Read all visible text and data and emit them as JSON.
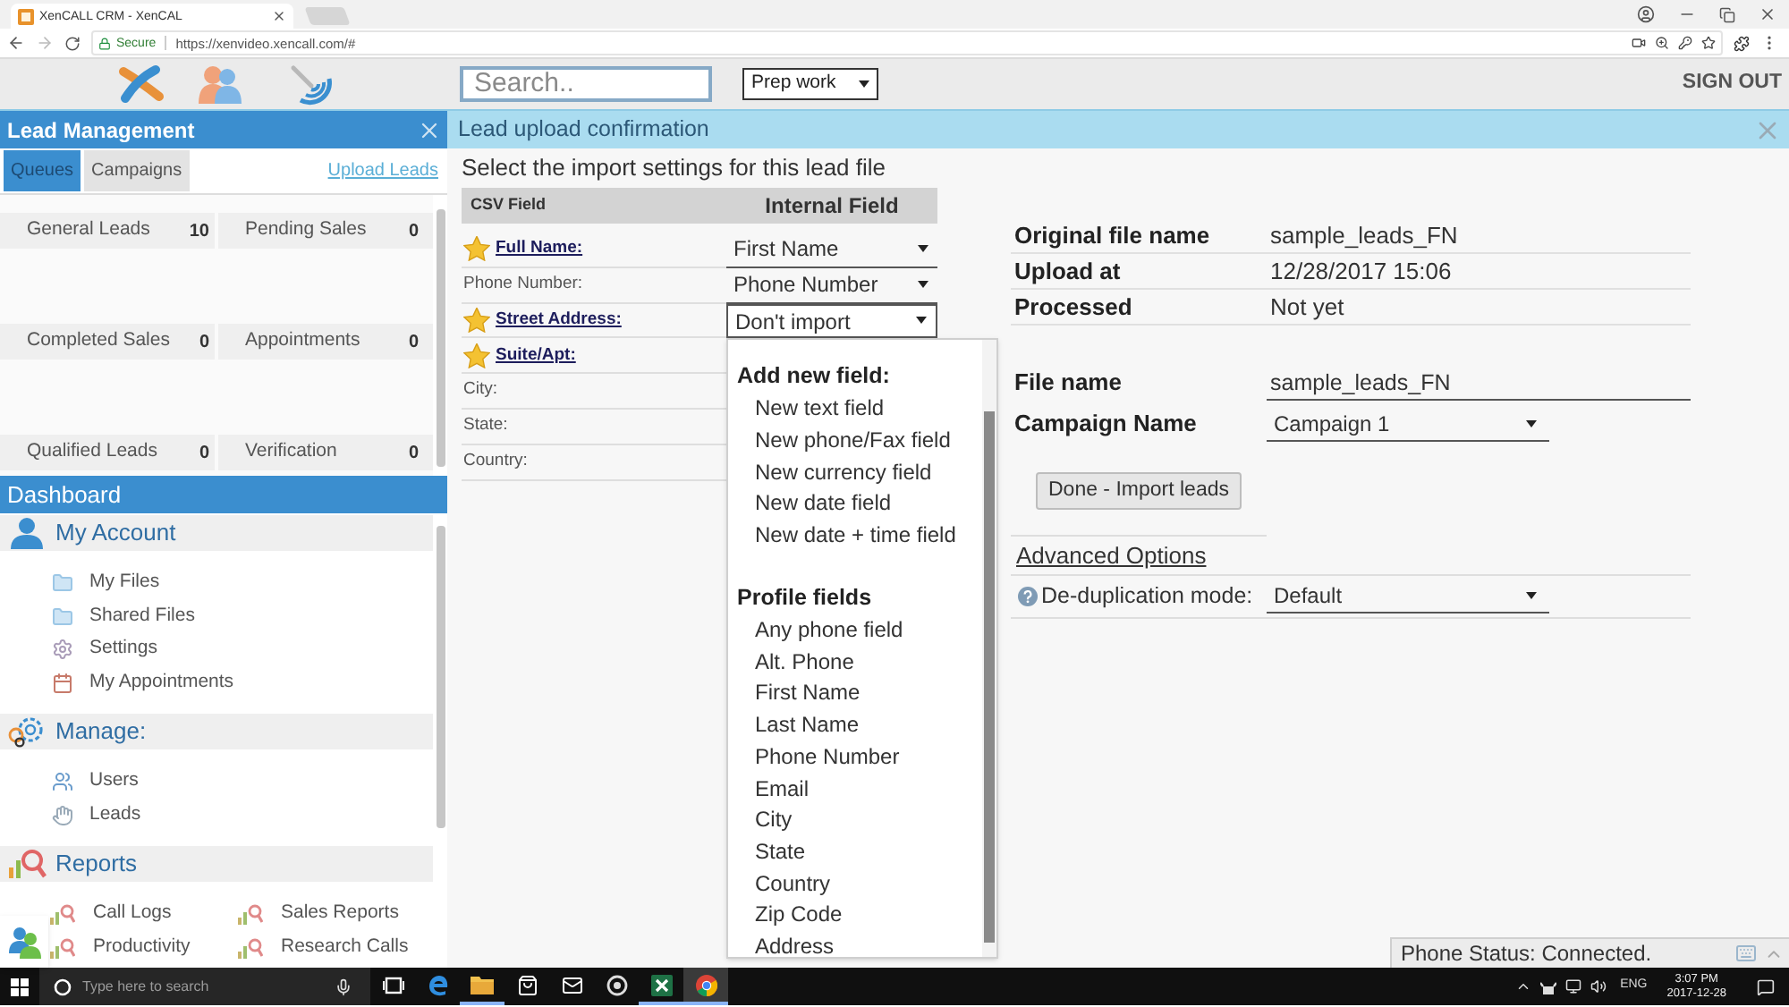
{
  "browser": {
    "tabs": [
      {
        "title": "XenCALL CRM - XenCAL",
        "selected": true
      }
    ],
    "secure_label": "Secure",
    "url": "https://xenvideo.xencall.com/#"
  },
  "header": {
    "search": {
      "placeholder": "Search.."
    },
    "status": {
      "value": "Prep work"
    },
    "sign_out": "SIGN OUT"
  },
  "lead_management": {
    "title": "Lead Management",
    "tabs": [
      {
        "label": "Queues",
        "selected": true
      },
      {
        "label": "Campaigns",
        "selected": false
      }
    ],
    "upload_link": "Upload Leads",
    "queues": [
      {
        "name": "General Leads",
        "count": "10"
      },
      {
        "name": "Pending Sales",
        "count": "0"
      },
      {
        "name": "Completed Sales",
        "count": "0"
      },
      {
        "name": "Appointments",
        "count": "0"
      },
      {
        "name": "Qualified Leads",
        "count": "0"
      },
      {
        "name": "Verification",
        "count": "0"
      }
    ]
  },
  "dashboard": {
    "title": "Dashboard",
    "sections": [
      {
        "title": "My Account",
        "kind": "list",
        "items": [
          "My Files",
          "Shared Files",
          "Settings",
          "My Appointments"
        ]
      },
      {
        "title": "Manage:",
        "kind": "list",
        "items": [
          "Users",
          "Leads"
        ]
      },
      {
        "title": "Reports",
        "kind": "grid",
        "items": [
          "Call Logs",
          "Sales Reports",
          "Productivity",
          "Research Calls"
        ]
      }
    ]
  },
  "upload": {
    "title": "Lead upload confirmation",
    "intro": "Select the import settings for this lead file",
    "mapping": {
      "columns": [
        "CSV Field",
        "Internal Field"
      ],
      "rows": [
        {
          "field": "Full Name:",
          "required": true,
          "value": "First Name",
          "expanded": false
        },
        {
          "field": "Phone Number:",
          "required": false,
          "value": "Phone Number",
          "expanded": false
        },
        {
          "field": "Street Address:",
          "required": true,
          "value": "Don't import",
          "expanded": true
        },
        {
          "field": "Suite/Apt:",
          "required": true
        },
        {
          "field": "City:",
          "required": false
        },
        {
          "field": "State:",
          "required": false
        },
        {
          "field": "Country:",
          "required": false
        }
      ]
    },
    "dropdown": {
      "groups": [
        {
          "title": "Add new field:",
          "options": [
            "New text field",
            "New phone/Fax field",
            "New currency field",
            "New date field",
            "New date + time field"
          ]
        },
        {
          "title": "Profile fields",
          "options": [
            "Any phone field",
            "Alt. Phone",
            "First Name",
            "Last Name",
            "Phone Number",
            "Email",
            "City",
            "State",
            "Country",
            "Zip Code",
            "Address"
          ]
        }
      ]
    },
    "details": [
      {
        "label": "Original file name",
        "value": "sample_leads_FN"
      },
      {
        "label": "Upload at",
        "value": "12/28/2017 15:06"
      },
      {
        "label": "Processed",
        "value": "Not yet"
      }
    ],
    "file_name": {
      "label": "File name",
      "value": "sample_leads_FN"
    },
    "campaign": {
      "label": "Campaign Name",
      "value": "Campaign 1"
    },
    "submit": "Done - Import leads",
    "advanced_link": "Advanced Options",
    "dedup": {
      "label": "De-duplication mode:",
      "value": "Default"
    }
  },
  "phone_status": "Phone Status: Connected.",
  "taskbar": {
    "search_placeholder": "Type here to search",
    "apps": [
      {
        "selected": false,
        "running": false
      },
      {
        "selected": false,
        "running": false
      },
      {
        "selected": false,
        "running": true
      },
      {
        "selected": false,
        "running": false
      },
      {
        "selected": false,
        "running": false
      },
      {
        "selected": false,
        "running": false
      },
      {
        "selected": false,
        "running": true
      },
      {
        "selected": true,
        "running": true
      }
    ],
    "language": "ENG",
    "time": "3:07 PM",
    "date": "2017-12-28"
  }
}
